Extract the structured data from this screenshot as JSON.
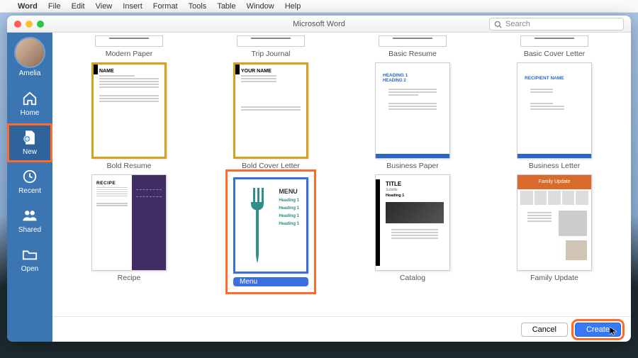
{
  "menubar": {
    "app": "Word",
    "items": [
      "File",
      "Edit",
      "View",
      "Insert",
      "Format",
      "Tools",
      "Table",
      "Window",
      "Help"
    ]
  },
  "window": {
    "title": "Microsoft Word"
  },
  "search": {
    "placeholder": "Search"
  },
  "user": {
    "name": "Amelia"
  },
  "sidebar": {
    "items": [
      {
        "id": "home",
        "label": "Home"
      },
      {
        "id": "new",
        "label": "New"
      },
      {
        "id": "recent",
        "label": "Recent"
      },
      {
        "id": "shared",
        "label": "Shared"
      },
      {
        "id": "open",
        "label": "Open"
      }
    ]
  },
  "templates": {
    "row0": [
      {
        "label": "Modern Paper"
      },
      {
        "label": "Trip Journal"
      },
      {
        "label": "Basic Resume"
      },
      {
        "label": "Basic Cover Letter"
      }
    ],
    "row1": [
      {
        "label": "Bold Resume",
        "preview": {
          "name": "NAME"
        }
      },
      {
        "label": "Bold Cover Letter",
        "preview": {
          "name": "YOUR NAME"
        }
      },
      {
        "label": "Business Paper",
        "preview": {
          "h1": "HEADING 1",
          "h2": "HEADING 2"
        }
      },
      {
        "label": "Business Letter",
        "preview": {
          "h1": "RECIPIENT NAME"
        }
      }
    ],
    "row2": [
      {
        "label": "Recipe",
        "preview": {
          "title": "RECIPE"
        }
      },
      {
        "label": "Menu",
        "preview": {
          "title": "MENU",
          "h": "Heading 1"
        }
      },
      {
        "label": "Catalog",
        "preview": {
          "title": "TITLE",
          "sub": "Subtitle",
          "h": "Heading 1"
        }
      },
      {
        "label": "Family Update",
        "preview": {
          "title": "Family Update"
        }
      }
    ]
  },
  "footer": {
    "cancel": "Cancel",
    "create": "Create"
  }
}
